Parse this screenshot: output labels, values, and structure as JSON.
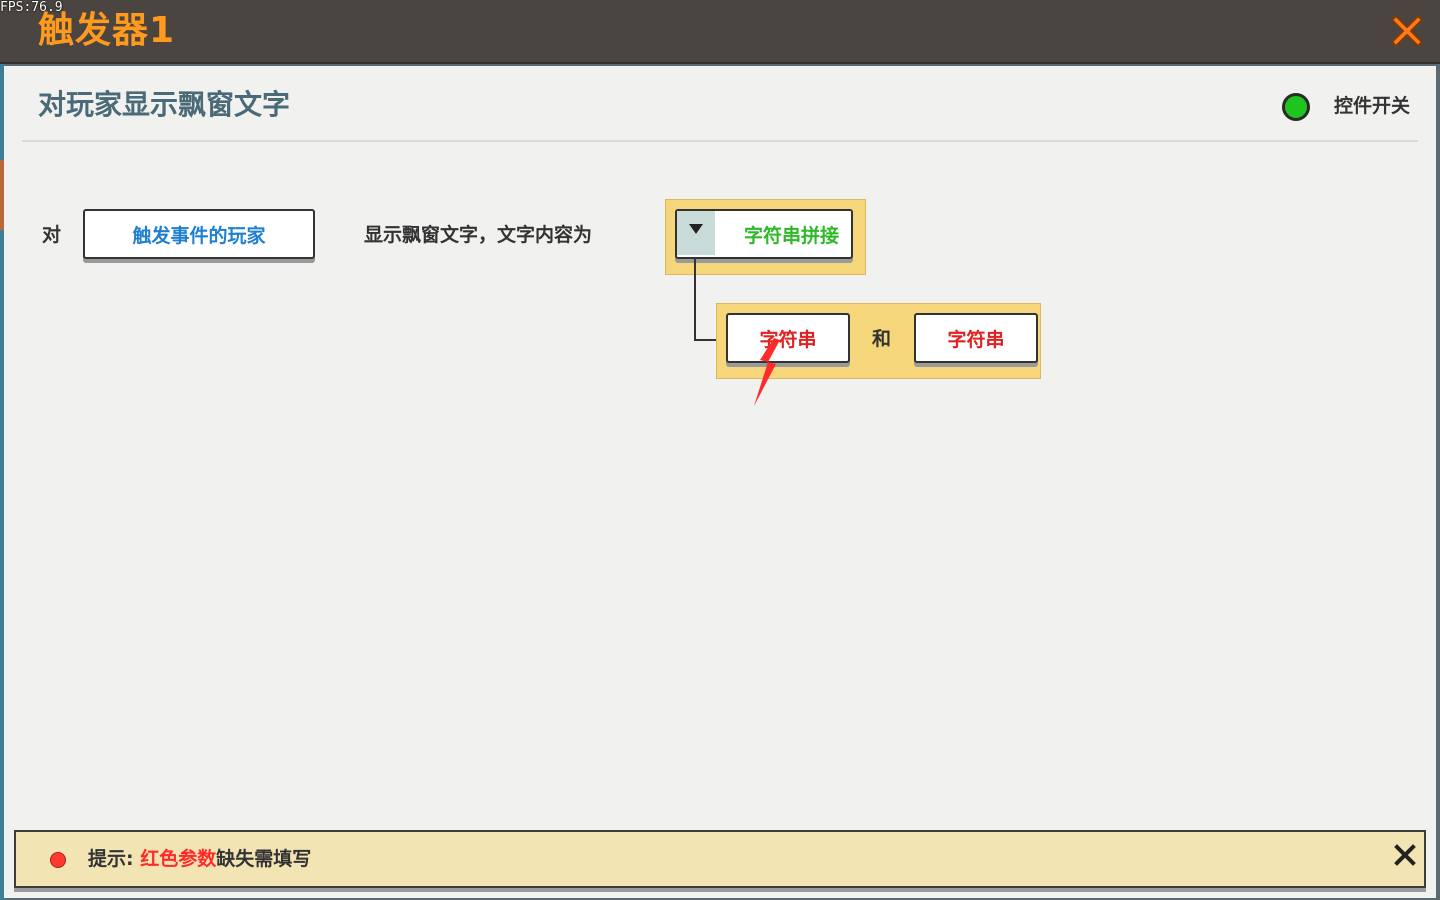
{
  "overlay": {
    "fps": "FPS:76.9"
  },
  "titlebar": {
    "title": "触发器1"
  },
  "panel": {
    "heading": "对玩家显示飘窗文字",
    "switch_label": "控件开关",
    "switch_color": "#1ec51c"
  },
  "statement": {
    "prefix": "对",
    "player_param": "触发事件的玩家",
    "middle_text": "显示飘窗文字，文字内容为",
    "concat_param": "字符串拼接",
    "string_a": "字符串",
    "joiner": "和",
    "string_b": "字符串"
  },
  "tip": {
    "prefix": "提示: ",
    "highlight": "红色参数",
    "suffix": "缺失需填写"
  },
  "colors": {
    "title": "#ff9a1e",
    "player_param": "#1f7fd0",
    "concat_param": "#2fb82a",
    "missing_param": "#e02222"
  },
  "icons": {
    "close": "close-x-icon",
    "dropdown": "triangle-down-icon",
    "pointer": "red-arrow-pointer-icon",
    "tip_close": "x-icon"
  }
}
